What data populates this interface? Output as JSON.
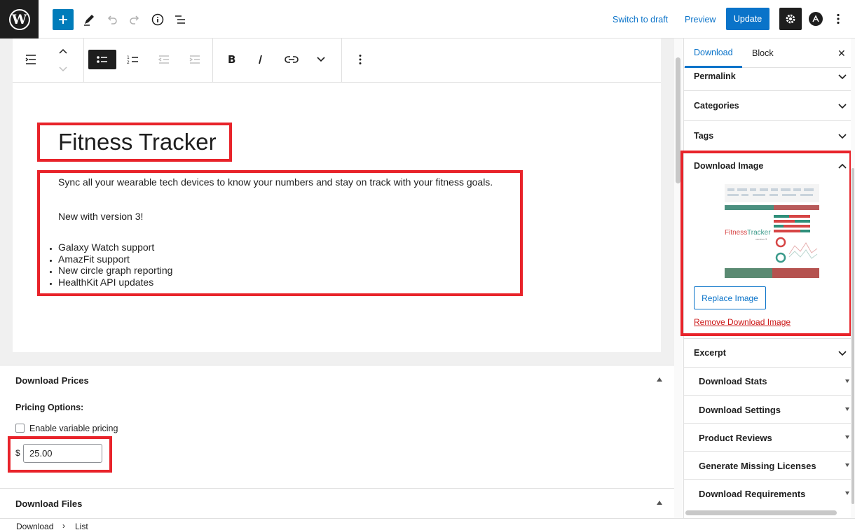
{
  "topbar": {
    "logo_letter": "W",
    "switch_to_draft": "Switch to draft",
    "preview": "Preview",
    "update": "Update"
  },
  "post": {
    "title": "Fitness Tracker",
    "paragraph_1": "Sync all your wearable tech devices to know your numbers and stay on track with your fitness goals.",
    "paragraph_2": "New with version 3!",
    "features": [
      "Galaxy Watch support",
      "AmazFit support",
      "New circle graph reporting",
      "HealthKit API updates"
    ]
  },
  "meta_boxes": {
    "download_prices": {
      "title": "Download Prices",
      "pricing_options_label": "Pricing Options:",
      "variable_pricing_label": "Enable variable pricing",
      "variable_pricing_checked": false,
      "currency_symbol": "$",
      "price_value": "25.00"
    },
    "download_files": {
      "title": "Download Files"
    }
  },
  "breadcrumb": {
    "items": [
      "Download",
      "List"
    ],
    "separator": "›"
  },
  "sidebar": {
    "tabs": [
      {
        "label": "Download",
        "active": true
      },
      {
        "label": "Block",
        "active": false
      }
    ],
    "close_glyph": "✕",
    "panels": [
      "Permalink",
      "Categories",
      "Tags"
    ],
    "download_image": {
      "title": "Download Image",
      "thumb_text_1": "Fitness",
      "thumb_text_2": "Tracker",
      "thumb_subtext": "version 3",
      "replace_label": "Replace Image",
      "remove_label": "Remove Download Image"
    },
    "excerpt": "Excerpt",
    "edd_boxes": [
      "Download Stats",
      "Download Settings",
      "Product Reviews",
      "Generate Missing Licenses",
      "Download Requirements"
    ]
  },
  "colors": {
    "accent": "#0a73c9",
    "highlight_border": "#e8232a",
    "remove_link": "#cc1818",
    "dark": "#1e1e1e"
  }
}
